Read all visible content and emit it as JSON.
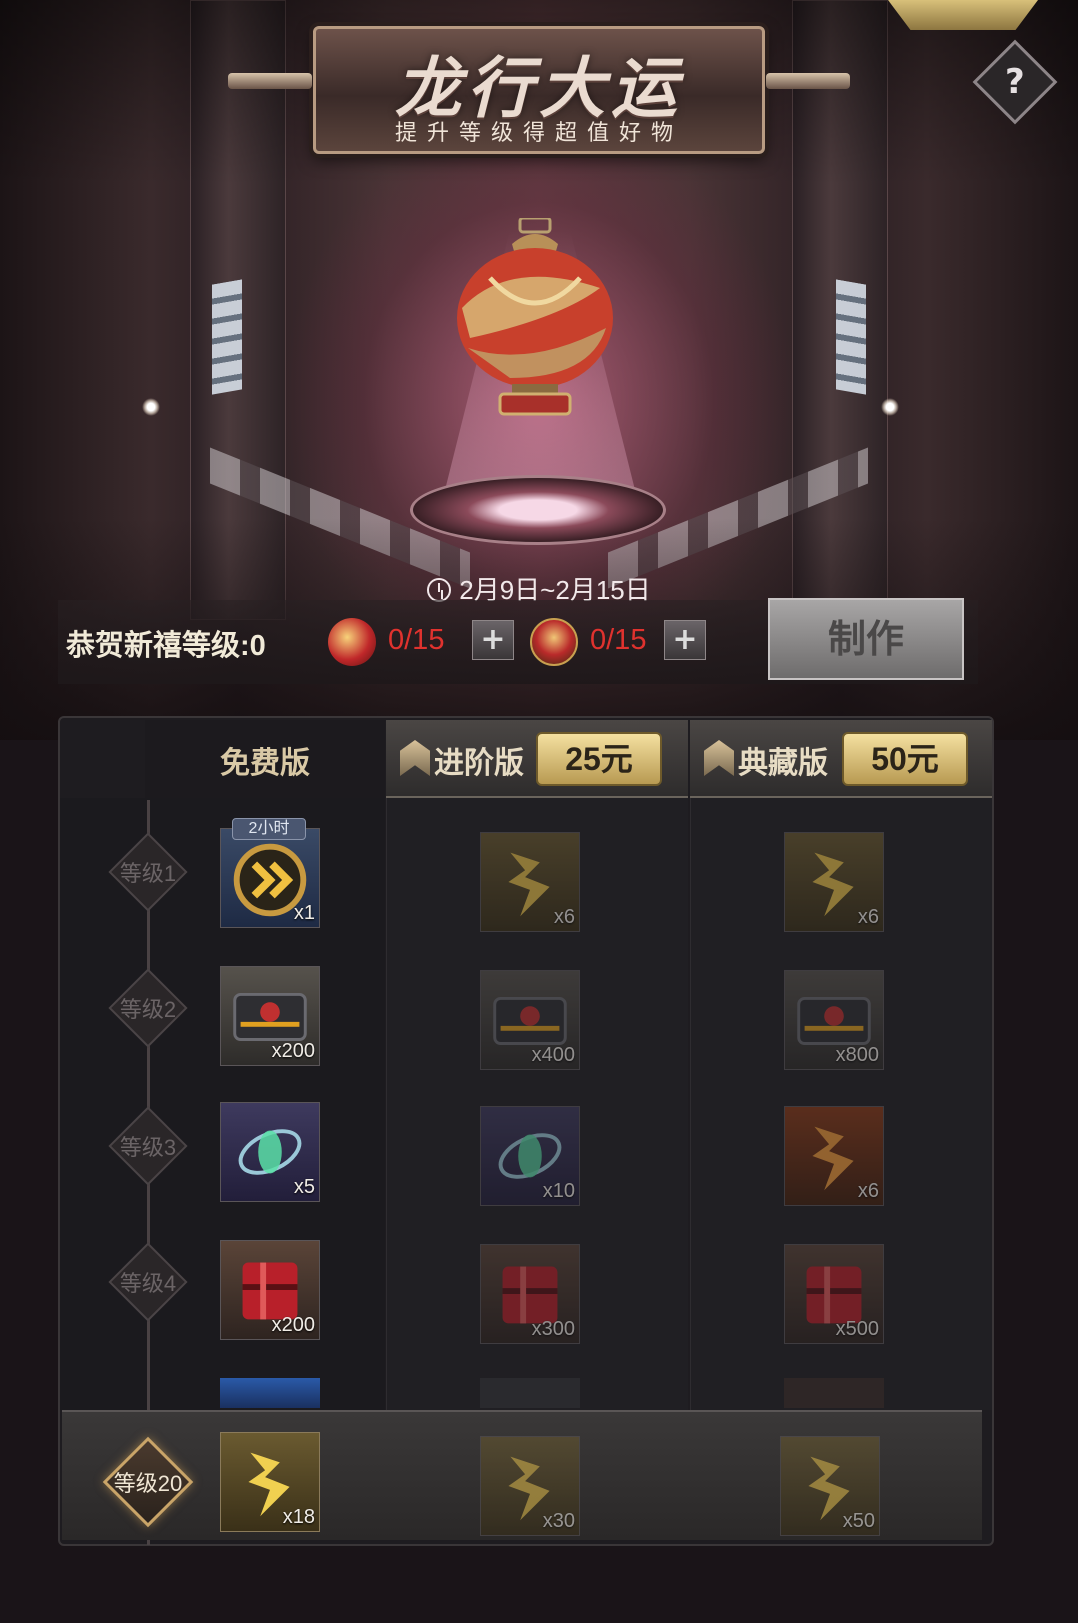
{
  "header": {
    "title": "龙行大运",
    "subtitle": "提升等级得超值好物",
    "help_label": "?",
    "date_range": "2月9日~2月15日"
  },
  "status": {
    "level_label": "恭贺新禧等级:0",
    "material_a_count": "0/15",
    "material_b_count": "0/15",
    "plus_label": "+",
    "make_label": "制作"
  },
  "columns": {
    "free": {
      "label": "免费版"
    },
    "advanced": {
      "label": "进阶版",
      "price": "25元"
    },
    "collector": {
      "label": "典藏版",
      "price": "50元"
    }
  },
  "time_tag": "2小时",
  "levels": [
    {
      "label": "等级1",
      "free_qty": "x1",
      "adv_qty": "x6",
      "col_qty": "x6"
    },
    {
      "label": "等级2",
      "free_qty": "x200",
      "adv_qty": "x400",
      "col_qty": "x800"
    },
    {
      "label": "等级3",
      "free_qty": "x5",
      "adv_qty": "x10",
      "col_qty": "x6"
    },
    {
      "label": "等级4",
      "free_qty": "x200",
      "adv_qty": "x300",
      "col_qty": "x500"
    }
  ],
  "final_level": {
    "label": "等级20",
    "free_qty": "x18",
    "adv_qty": "x30",
    "col_qty": "x50"
  },
  "colors": {
    "accent_gold": "#d8c07a",
    "counter_red": "#e0322e",
    "panel_bg": "#1e1c20"
  },
  "icons": {
    "speed_boost": "chevron-boost-icon",
    "gold_emblem": "gold-emblem-icon",
    "supply_crate": "supply-crate-icon",
    "energy_orb": "energy-orb-icon",
    "red_crate": "red-crate-icon"
  }
}
